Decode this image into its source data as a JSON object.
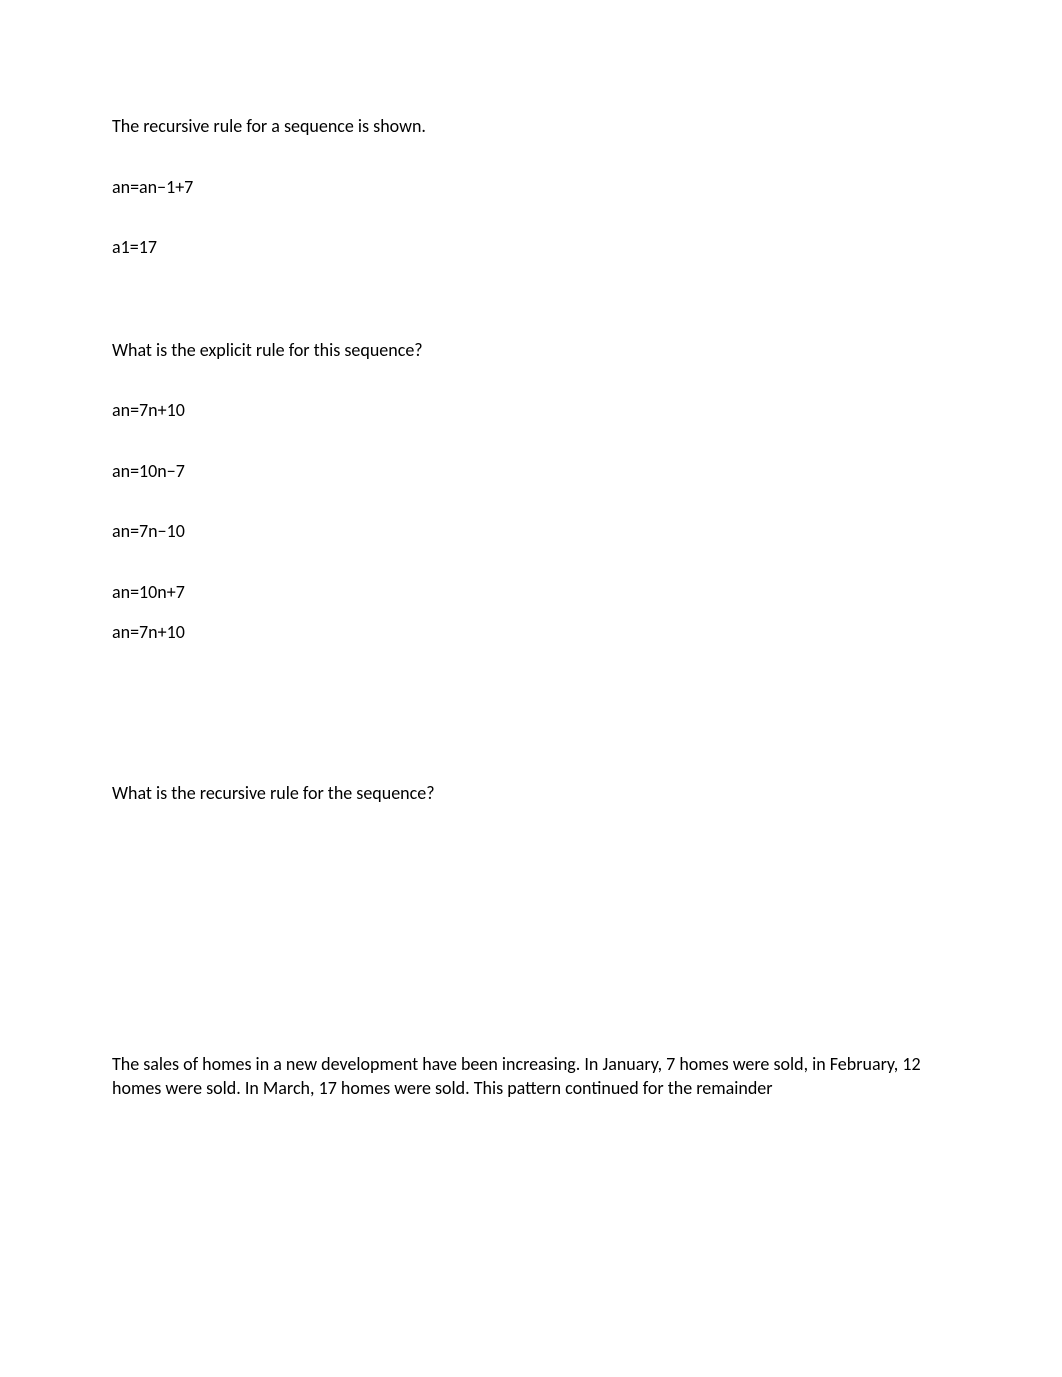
{
  "q1": {
    "intro": "The recursive rule for a sequence is shown.",
    "rule1": "an=an−1+7",
    "rule2": "a1=17",
    "prompt": "What is the explicit rule for this sequence?",
    "options": [
      "an=7n+10",
      "an=10n−7",
      "an=7n−10",
      "an=10n+7",
      "an=7n+10"
    ]
  },
  "q2": {
    "prompt": "What is the recursive rule for the sequence?"
  },
  "q3": {
    "text": "The sales of homes in a new development have been increasing. In January, 7 homes were sold, in February, 12 homes were sold. In March, 17 homes were sold. This pattern continued for the remainder"
  }
}
